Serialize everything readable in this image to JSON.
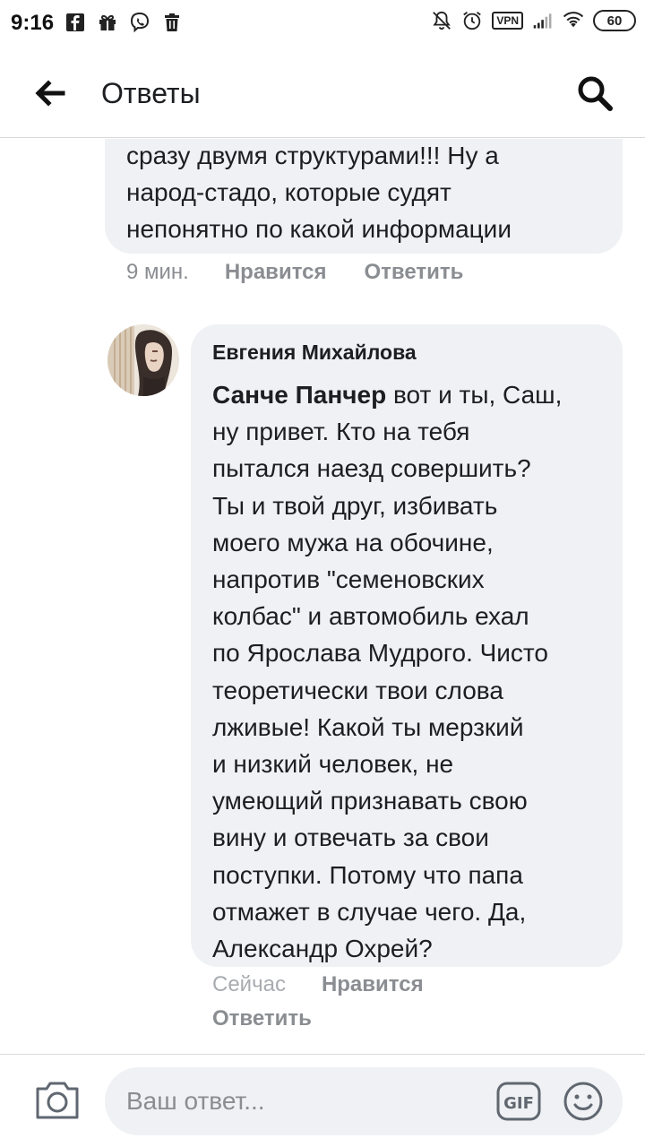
{
  "status_bar": {
    "time": "9:16",
    "vpn": "VPN",
    "battery": "60",
    "icons": [
      "facebook-icon",
      "gift-icon",
      "viber-icon",
      "trash-icon",
      "mute-icon",
      "alarm-icon",
      "vpn-icon",
      "signal-icon",
      "wifi-icon",
      "battery-icon"
    ]
  },
  "header": {
    "title": "Ответы",
    "back_icon": "back-arrow-icon",
    "search_icon": "search-icon"
  },
  "previous_comment": {
    "lines": [
      "сразу двумя структурами!!! Ну а",
      "народ-стадо, которые судят",
      "непонятно по какой информации"
    ],
    "time": "9 мин.",
    "like": "Нравится",
    "reply": "Ответить"
  },
  "comment": {
    "author": "Евгения Михайлова",
    "mention": "Санче Панчер",
    "lines": [
      " вот и ты, Саш,",
      "ну привет. Кто на тебя",
      "пытался наезд совершить?",
      "Ты и твой друг, избивать",
      "моего мужа на обочине,",
      "напротив \"семеновских",
      "колбас\" и автомобиль ехал",
      "по Ярослава Мудрого. Чисто",
      "теоретически твои слова",
      "лживые! Какой ты мерзкий",
      "и низкий человек, не",
      "умеющий признавать свою",
      "вину и отвечать за свои",
      "поступки. Потому что папа",
      "отмажет в случае чего. Да,",
      "Александр Охрей?"
    ],
    "time": "Сейчас",
    "like": "Нравится",
    "reply": "Ответить"
  },
  "composer": {
    "placeholder": "Ваш ответ...",
    "camera_icon": "camera-icon",
    "gif_icon": "gif-icon",
    "emoji_icon": "emoji-icon"
  },
  "colors": {
    "bubble": "#eff1f4",
    "meta_text": "#8a8d91",
    "primary_text": "#1c1e21"
  }
}
